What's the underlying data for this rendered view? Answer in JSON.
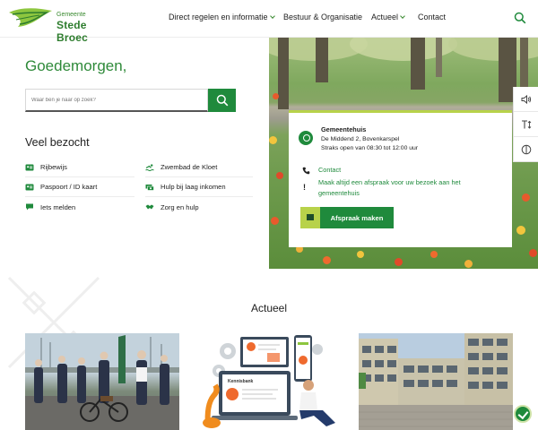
{
  "header": {
    "logo_small": "Gemeente",
    "logo_big": "Stede Broec",
    "nav": [
      {
        "label": "Direct regelen en informatie",
        "has_dropdown": true
      },
      {
        "label": "Bestuur & Organisatie",
        "has_dropdown": false
      },
      {
        "label": "Actueel",
        "has_dropdown": true
      },
      {
        "label": "Contact",
        "has_dropdown": false
      }
    ]
  },
  "main": {
    "greeting": "Goedemorgen,",
    "search_placeholder": "Waar ben je naar op zoek?",
    "veel_bezocht_title": "Veel bezocht",
    "quick_links": [
      {
        "label": "Rijbewijs",
        "icon": "id-card-icon"
      },
      {
        "label": "Zwembad de Kloet",
        "icon": "swimmer-icon"
      },
      {
        "label": "Paspoort / ID kaart",
        "icon": "id-card-icon"
      },
      {
        "label": "Hulp bij laag inkomen",
        "icon": "money-icon"
      },
      {
        "label": "Iets melden",
        "icon": "chat-icon"
      },
      {
        "label": "Zorg en hulp",
        "icon": "handshake-icon"
      }
    ]
  },
  "info_card": {
    "name": "Gemeentehuis",
    "address": "De Middend 2, Bovenkarspel",
    "hours": "Straks open van 08:30 tot 12:00 uur",
    "contact_label": "Contact",
    "note": "Maak altijd een afspraak voor uw bezoek aan het gemeentehuis",
    "button_label": "Afspraak maken"
  },
  "side_tools": [
    "speaker-icon",
    "text-size-icon",
    "contrast-icon"
  ],
  "actueel": {
    "title": "Actueel",
    "card2_labels": [
      "Kennisbank"
    ]
  },
  "colors": {
    "brand_green": "#1f8a3c",
    "lime": "#b8d24a",
    "greeting_green": "#2f8a3a"
  }
}
